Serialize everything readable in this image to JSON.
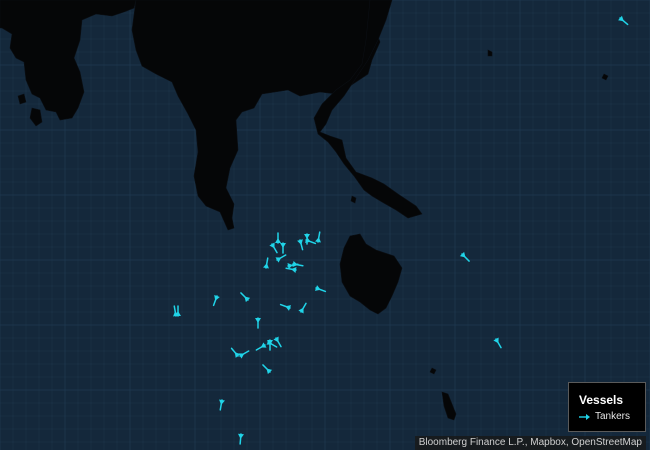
{
  "colors": {
    "water": "#14283b",
    "land": "#050607",
    "grid": "#1f3a52",
    "vessel": "#20d4e8",
    "legend_bg": "#000000"
  },
  "legend": {
    "title": "Vessels",
    "items": [
      {
        "label": "Tankers",
        "icon": "arrow-icon",
        "color": "#20d4e8"
      }
    ]
  },
  "attribution": "Bloomberg Finance L.P., Mapbox, OpenStreetMap",
  "vessels": [
    {
      "type": "tanker",
      "heading": 40
    },
    {
      "type": "tanker",
      "heading": 45
    },
    {
      "type": "tanker",
      "heading": 280
    },
    {
      "type": "tanker",
      "heading": 270
    },
    {
      "type": "tanker",
      "heading": 60
    },
    {
      "type": "tanker",
      "heading": 75
    },
    {
      "type": "tanker",
      "heading": 90
    },
    {
      "type": "tanker",
      "heading": 330
    },
    {
      "type": "tanker",
      "heading": 10
    },
    {
      "type": "tanker",
      "heading": 190
    },
    {
      "type": "tanker",
      "heading": 350
    },
    {
      "type": "tanker",
      "heading": 280
    },
    {
      "type": "tanker",
      "heading": 20
    },
    {
      "type": "tanker",
      "heading": 225
    },
    {
      "type": "tanker",
      "heading": 110
    },
    {
      "type": "tanker",
      "heading": 200
    },
    {
      "type": "tanker",
      "heading": 90
    },
    {
      "type": "tanker",
      "heading": 300
    },
    {
      "type": "tanker",
      "heading": 260
    },
    {
      "type": "tanker",
      "heading": 90
    },
    {
      "type": "tanker",
      "heading": 60
    },
    {
      "type": "tanker",
      "heading": 30
    },
    {
      "type": "tanker",
      "heading": 330
    },
    {
      "type": "tanker",
      "heading": 225
    },
    {
      "type": "tanker",
      "heading": 230
    },
    {
      "type": "tanker",
      "heading": 100
    },
    {
      "type": "tanker",
      "heading": 95
    },
    {
      "type": "tanker",
      "heading": 270
    },
    {
      "type": "tanker",
      "heading": 20
    },
    {
      "type": "tanker",
      "heading": 150
    },
    {
      "type": "tanker",
      "heading": 60
    },
    {
      "type": "tanker",
      "heading": 90
    }
  ]
}
